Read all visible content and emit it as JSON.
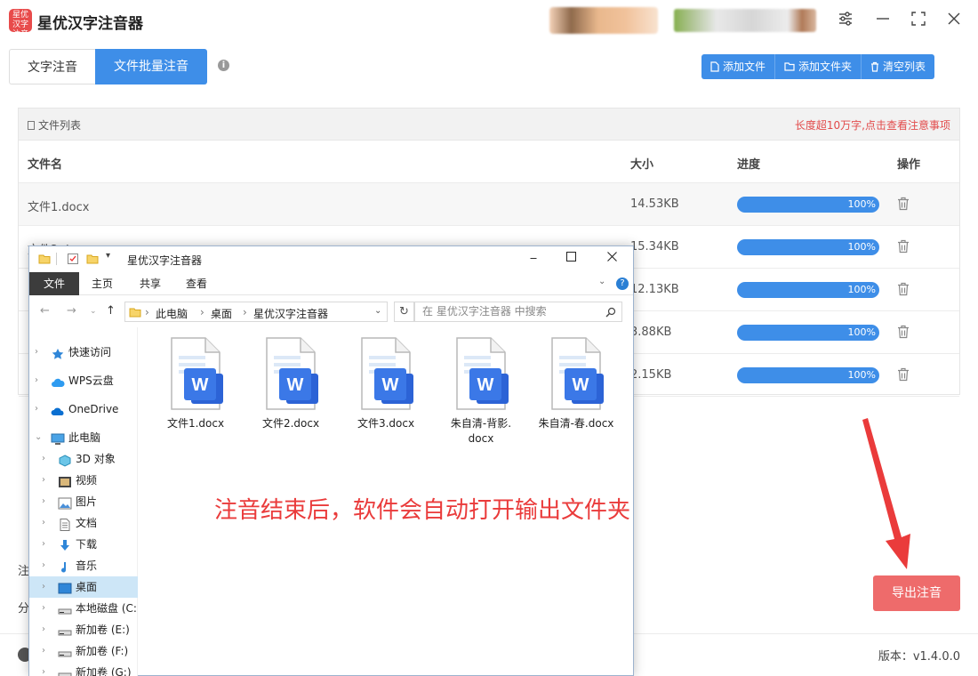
{
  "app": {
    "title": "星优汉字注音器",
    "logo_text": "星优汉字注音"
  },
  "tabs": [
    {
      "label": "文字注音"
    },
    {
      "label": "文件批量注音"
    }
  ],
  "info_icon": "i",
  "toolbar": {
    "add_file": "添加文件",
    "add_folder": "添加文件夹",
    "clear_list": "清空列表"
  },
  "file_list": {
    "title": "文件列表",
    "warning": "长度超10万字,点击查看注意事项",
    "columns": {
      "name": "文件名",
      "size": "大小",
      "progress": "进度",
      "action": "操作"
    },
    "rows": [
      {
        "name": "文件1.docx",
        "size": "14.53KB",
        "progress": "100%",
        "progress_value": 1.0
      },
      {
        "name": "文件2.d",
        "size": "15.34KB",
        "progress": "100%",
        "progress_value": 1.0
      },
      {
        "name": "",
        "size": "12.13KB",
        "progress": "100%",
        "progress_value": 1.0
      },
      {
        "name": "",
        "size": "3.88KB",
        "progress": "100%",
        "progress_value": 1.0
      },
      {
        "name": "",
        "size": "2.15KB",
        "progress": "100%",
        "progress_value": 1.0
      }
    ]
  },
  "bottom": {
    "side_label_1": "注",
    "side_label_2": "分",
    "export_button": "导出注音",
    "version": "版本：v1.4.0.0"
  },
  "caption": "注音结束后，软件会自动打开输出文件夹",
  "explorer": {
    "title": "星优汉字注音器",
    "ribbon_tabs": [
      "文件",
      "主页",
      "共享",
      "查看"
    ],
    "breadcrumb": [
      "此电脑",
      "桌面",
      "星优汉字注音器"
    ],
    "search_placeholder": "在 星优汉字注音器 中搜索",
    "nav_items": [
      {
        "label": "快速访问",
        "icon": "star-icon"
      },
      {
        "label": "WPS云盘",
        "icon": "cloud-icon"
      },
      {
        "label": "OneDrive",
        "icon": "onedrive-icon"
      },
      {
        "label": "此电脑",
        "icon": "computer-icon"
      },
      {
        "label": "3D 对象",
        "icon": "cube-icon"
      },
      {
        "label": "视频",
        "icon": "video-icon"
      },
      {
        "label": "图片",
        "icon": "picture-icon"
      },
      {
        "label": "文档",
        "icon": "document-icon"
      },
      {
        "label": "下载",
        "icon": "download-icon"
      },
      {
        "label": "音乐",
        "icon": "music-icon"
      },
      {
        "label": "桌面",
        "icon": "desktop-icon"
      },
      {
        "label": "本地磁盘 (C:",
        "icon": "drive-icon"
      },
      {
        "label": "新加卷 (E:)",
        "icon": "drive-icon"
      },
      {
        "label": "新加卷 (F:)",
        "icon": "drive-icon"
      },
      {
        "label": "新加卷 (G:)",
        "icon": "drive-icon"
      }
    ],
    "files": [
      {
        "name": "文件1.docx"
      },
      {
        "name": "文件2.docx"
      },
      {
        "name": "文件3.docx"
      },
      {
        "name": "朱自清-背影.\ndocx"
      },
      {
        "name": "朱自清-春.docx"
      }
    ],
    "word_glyph": "W"
  },
  "colors": {
    "accent": "#3e8ee8",
    "export": "#ee6b6b",
    "caption": "#ea3b3b",
    "warning": "#e24b4b"
  }
}
